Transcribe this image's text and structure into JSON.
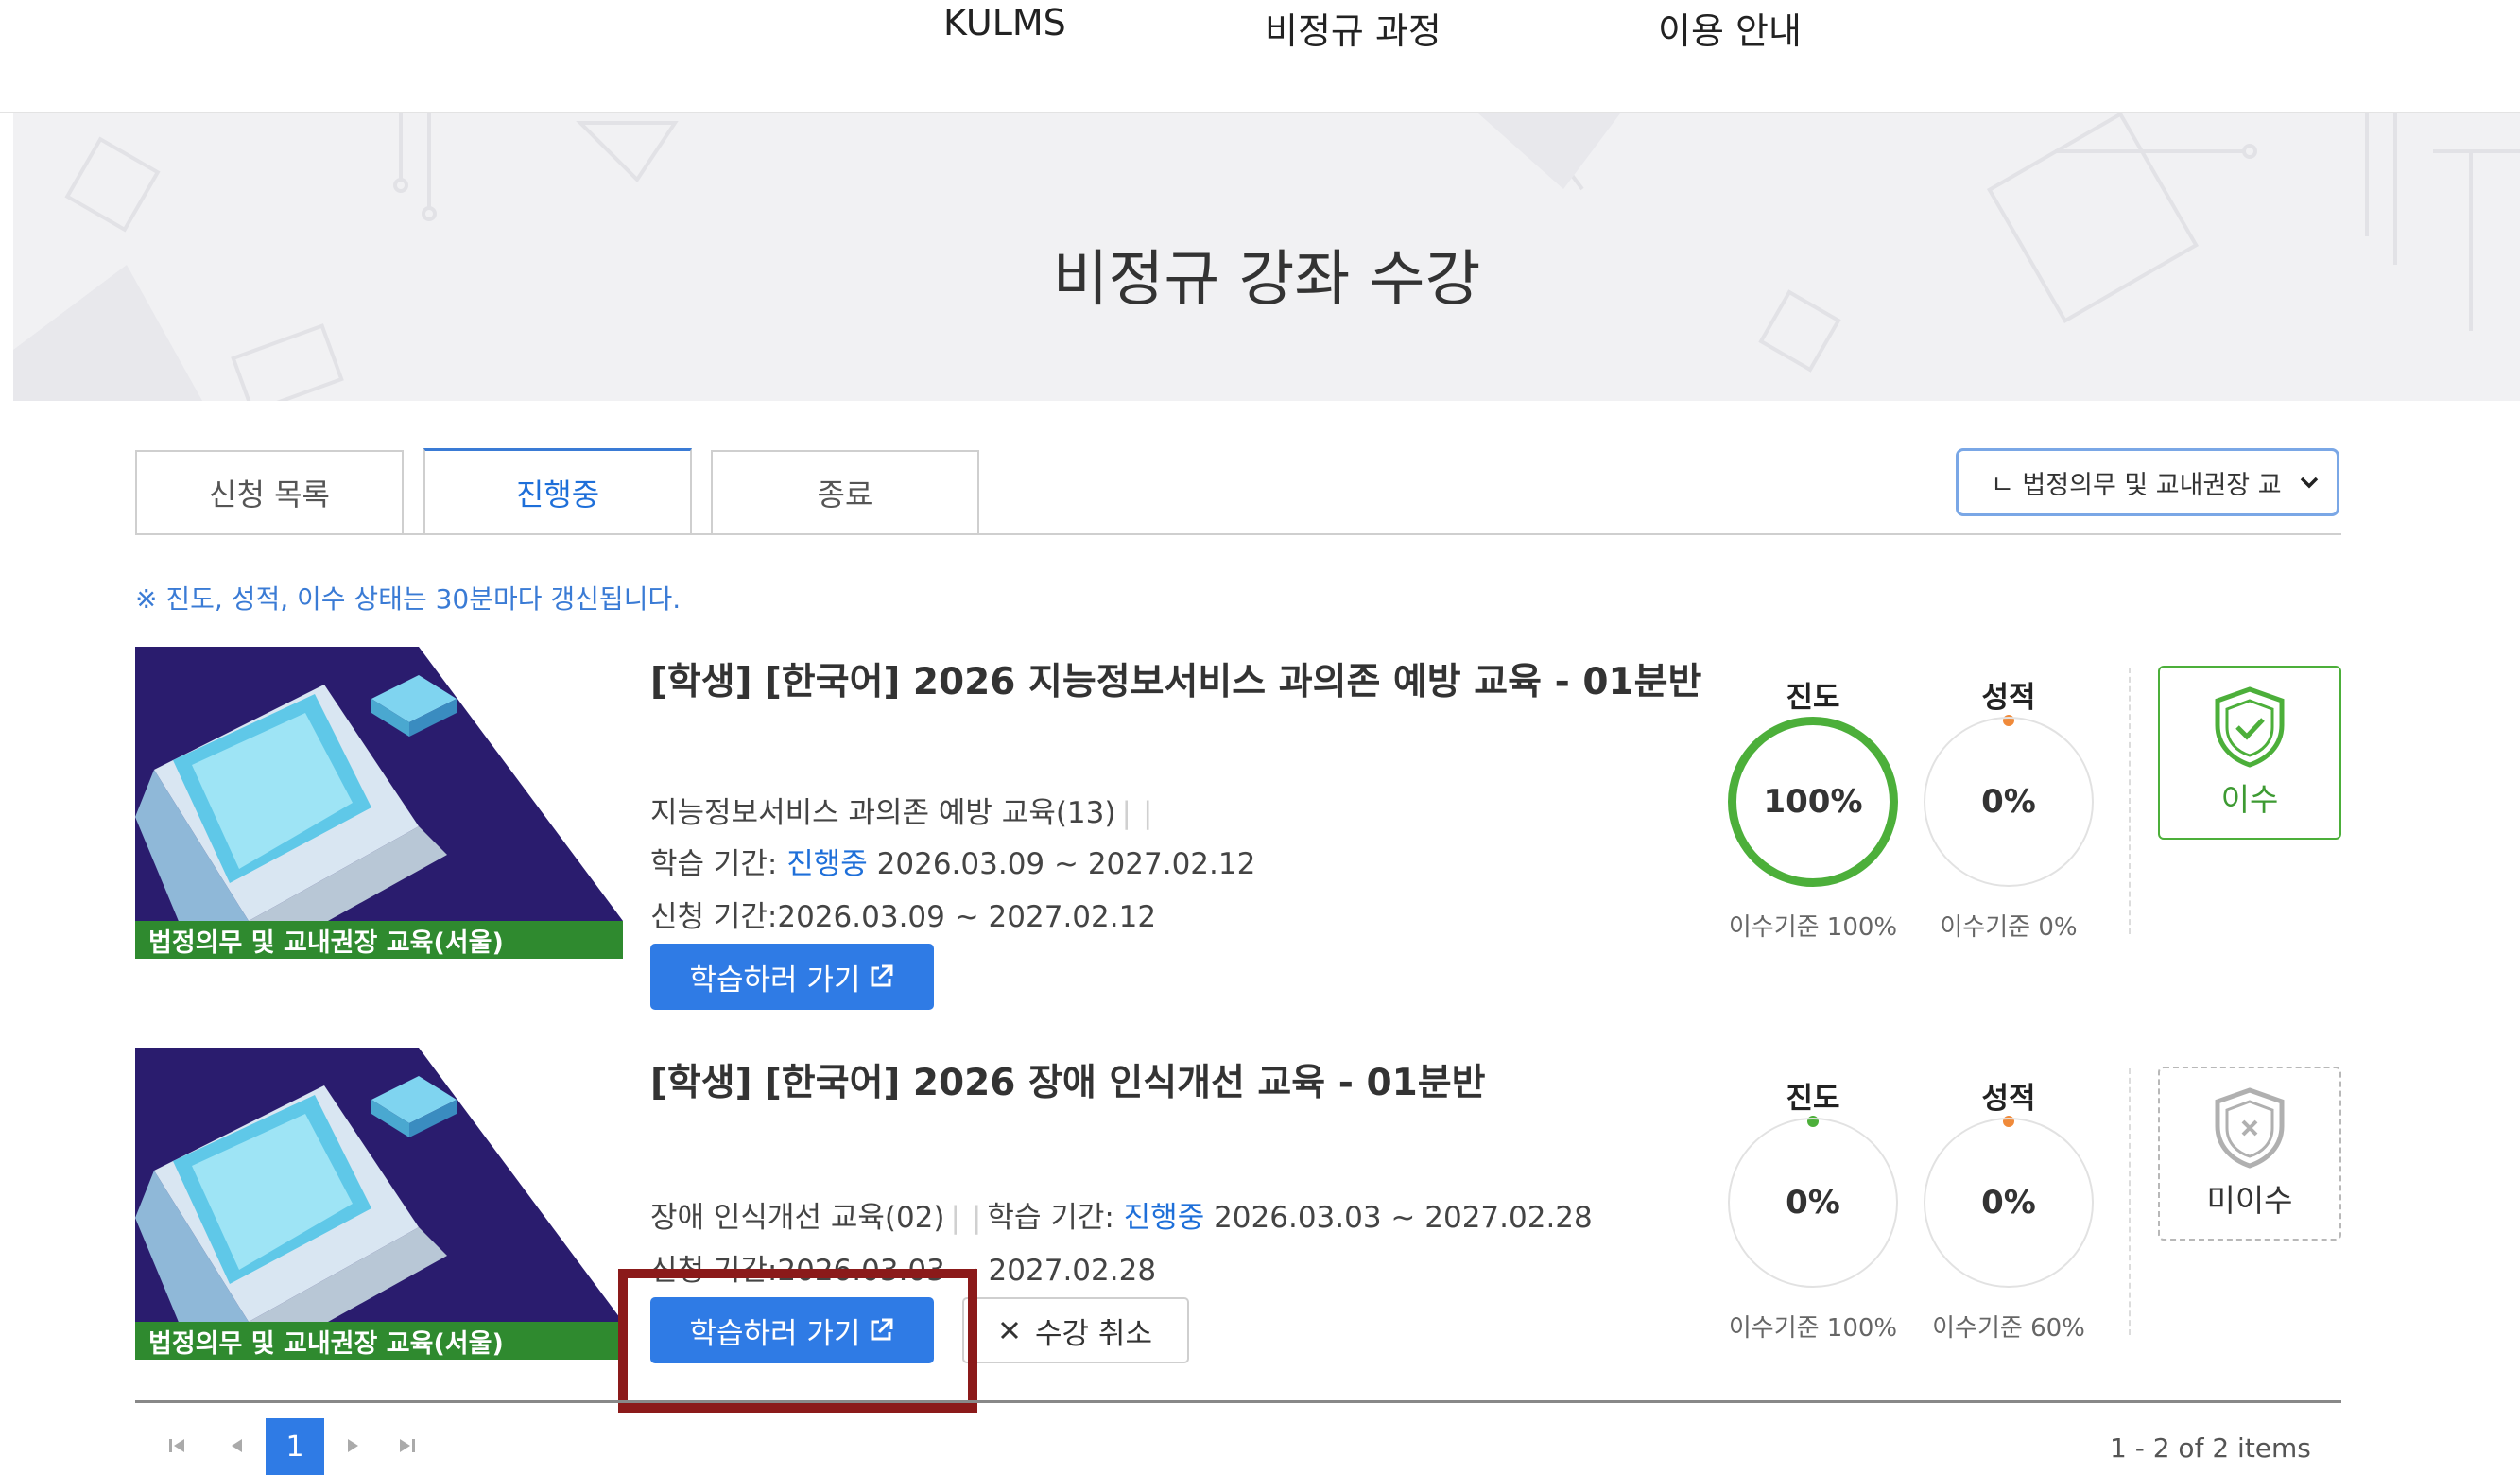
{
  "nav": {
    "items": [
      "KULMS",
      "비정규 과정",
      "이용 안내"
    ]
  },
  "hero": {
    "title": "비정규 강좌 수강"
  },
  "tabs": [
    "신청 목록",
    "진행중",
    "종료"
  ],
  "filter": {
    "selected": "ㄴ 법정의무 및 교내권장 교"
  },
  "notice": "※ 진도, 성적, 이수 상태는 30분마다 갱신됩니다.",
  "courses": [
    {
      "category": "법정의무 및 교내권장 교육(서울)",
      "title": "[학생] [한국어] 2026 지능정보서비스 과의존 예방 교육 - 01분반",
      "subject": "지능정보서비스 과의존 예방 교육(13)",
      "period_label": "학습 기간: ",
      "status": "진행중",
      "period": " 2026.03.09 ~ 2027.02.12",
      "apply": "신청 기간:2026.03.09 ~ 2027.02.12",
      "study_button": "학습하러 가기",
      "progress_label": "진도",
      "progress": "100%",
      "progress_req": "이수기준 100%",
      "grade_label": "성적",
      "grade": "0%",
      "grade_req": "이수기준 0%",
      "completion": "이수"
    },
    {
      "category": "법정의무 및 교내권장 교육(서울)",
      "title": "[학생] [한국어] 2026 장애 인식개선 교육 - 01분반",
      "subject": "장애 인식개선 교육(02)",
      "period_label": "학습 기간: ",
      "status": "진행중",
      "period": " 2026.03.03 ~ 2027.02.28",
      "apply": "신청 기간:2026.03.03 ~ 2027.02.28",
      "study_button": "학습하러 가기",
      "cancel_button": "수강 취소",
      "progress_label": "진도",
      "progress": "0%",
      "progress_req": "이수기준 100%",
      "grade_label": "성적",
      "grade": "0%",
      "grade_req": "이수기준 60%",
      "completion": "미이수"
    }
  ],
  "pagination": {
    "current": "1",
    "summary": "1 - 2 of 2 items"
  },
  "colors": {
    "accent": "#2f7be5",
    "complete": "#4caf3a",
    "highlight_box": "#8b1a1a"
  }
}
